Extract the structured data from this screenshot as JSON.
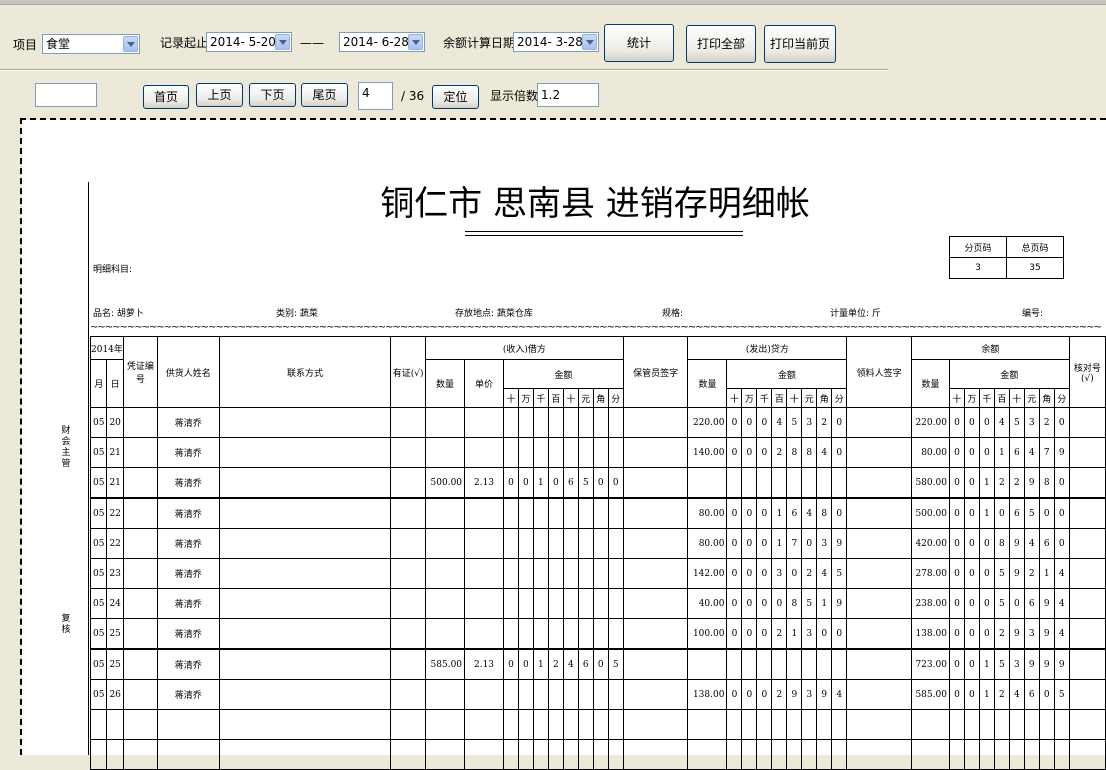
{
  "toolbar": {
    "project_label": "项目",
    "project_value": "食堂",
    "record_label": "记录起止",
    "date_from": "2014- 5-20",
    "dash": "——",
    "date_to": "2014- 6-28",
    "balance_label": "余额计算日期",
    "balance_date": "2014- 3-28",
    "stats_button": "统计",
    "print_all_button": "打印全部",
    "print_current_button": "打印当前页"
  },
  "nav": {
    "search_value": "",
    "first_button": "首页",
    "prev_button": "上页",
    "next_button": "下页",
    "last_button": "尾页",
    "page_value": "4",
    "page_total": "/ 36",
    "locate_button": "定位",
    "zoom_label": "显示倍数",
    "zoom_value": "1.2"
  },
  "doc": {
    "title": "铜仁市 思南县 进销存明细帐",
    "detail_subject": "明细科目:",
    "product_name": "品名: 胡萝卜",
    "category": "类别: 蔬菜",
    "storage": "存放地点: 蔬菜仓库",
    "spec": "规格:",
    "unit": "计量单位: 斤",
    "number": "编号:",
    "side_label_1": "财会主管",
    "side_label_2": "复核",
    "tilde": "~~~~~~~~~~~~~~~~~~~~~~~~~~~~~~~~~~~~~~~~~~~~~~~~~~~~~~~~~~~~~~~~~~~~~~~~~~~~~~~~~~~~~~~~~~~~~~~~~~~~~~~~~~~~~~~~~~~~~~~~~~~~~~~~~~~~~~~~~~~~~~~~~~~~~~~~~~~~~~~~~~~~~~~~~~~~~~~~~~~~~~~~~~~~~~~~~~~~"
  },
  "page_box": {
    "sub_page_label": "分页码",
    "total_page_label": "总页码",
    "sub_page": "3",
    "total_page": "35"
  },
  "headers": {
    "year": "2014年",
    "month": "月",
    "day": "日",
    "voucher": "凭证编号",
    "supplier": "供货人姓名",
    "contact": "联系方式",
    "has_voucher": "有证(√)",
    "in_section": "(收入)借方",
    "in_qty": "数量",
    "in_price": "单价",
    "in_amount": "金额",
    "keeper": "保管员签字",
    "out_section": "(发出)贷方",
    "out_qty": "数量",
    "out_amount": "金额",
    "receiver": "领料人签字",
    "bal_section": "余额",
    "bal_qty": "数量",
    "bal_amount": "金额",
    "check": "核对号(√)",
    "digits": [
      "十",
      "万",
      "千",
      "百",
      "十",
      "元",
      "角",
      "分"
    ]
  },
  "rows": [
    {
      "m": "05",
      "d": "20",
      "supplier": "蒋清乔",
      "in_qty": "",
      "in_price": "",
      "in_digits": [
        "",
        "",
        "",
        "",
        "",
        "",
        "",
        ""
      ],
      "out_qty": "220.00",
      "out_digits": [
        "0",
        "0",
        "0",
        "4",
        "5",
        "3",
        "2",
        "0"
      ],
      "bal_qty": "220.00",
      "bal_digits": [
        "0",
        "0",
        "0",
        "4",
        "5",
        "3",
        "2",
        "0"
      ]
    },
    {
      "m": "05",
      "d": "21",
      "supplier": "蒋清乔",
      "in_qty": "",
      "in_price": "",
      "in_digits": [
        "",
        "",
        "",
        "",
        "",
        "",
        "",
        ""
      ],
      "out_qty": "140.00",
      "out_digits": [
        "0",
        "0",
        "0",
        "2",
        "8",
        "8",
        "4",
        "0"
      ],
      "bal_qty": "80.00",
      "bal_digits": [
        "0",
        "0",
        "0",
        "1",
        "6",
        "4",
        "7",
        "9"
      ]
    },
    {
      "m": "05",
      "d": "21",
      "supplier": "蒋清乔",
      "in_qty": "500.00",
      "in_price": "2.13",
      "in_digits": [
        "0",
        "0",
        "1",
        "0",
        "6",
        "5",
        "0",
        "0"
      ],
      "out_qty": "",
      "out_digits": [
        "",
        "",
        "",
        "",
        "",
        "",
        "",
        ""
      ],
      "bal_qty": "580.00",
      "bal_digits": [
        "0",
        "0",
        "1",
        "2",
        "2",
        "9",
        "8",
        "0"
      ]
    },
    {
      "m": "05",
      "d": "22",
      "supplier": "蒋清乔",
      "in_qty": "",
      "in_price": "",
      "in_digits": [
        "",
        "",
        "",
        "",
        "",
        "",
        "",
        ""
      ],
      "out_qty": "80.00",
      "out_digits": [
        "0",
        "0",
        "0",
        "1",
        "6",
        "4",
        "8",
        "0"
      ],
      "bal_qty": "500.00",
      "bal_digits": [
        "0",
        "0",
        "1",
        "0",
        "6",
        "5",
        "0",
        "0"
      ]
    },
    {
      "m": "05",
      "d": "22",
      "supplier": "蒋清乔",
      "in_qty": "",
      "in_price": "",
      "in_digits": [
        "",
        "",
        "",
        "",
        "",
        "",
        "",
        ""
      ],
      "out_qty": "80.00",
      "out_digits": [
        "0",
        "0",
        "0",
        "1",
        "7",
        "0",
        "3",
        "9"
      ],
      "bal_qty": "420.00",
      "bal_digits": [
        "0",
        "0",
        "0",
        "8",
        "9",
        "4",
        "6",
        "0"
      ]
    },
    {
      "m": "05",
      "d": "23",
      "supplier": "蒋清乔",
      "in_qty": "",
      "in_price": "",
      "in_digits": [
        "",
        "",
        "",
        "",
        "",
        "",
        "",
        ""
      ],
      "out_qty": "142.00",
      "out_digits": [
        "0",
        "0",
        "0",
        "3",
        "0",
        "2",
        "4",
        "5"
      ],
      "bal_qty": "278.00",
      "bal_digits": [
        "0",
        "0",
        "0",
        "5",
        "9",
        "2",
        "1",
        "4"
      ]
    },
    {
      "m": "05",
      "d": "24",
      "supplier": "蒋清乔",
      "in_qty": "",
      "in_price": "",
      "in_digits": [
        "",
        "",
        "",
        "",
        "",
        "",
        "",
        ""
      ],
      "out_qty": "40.00",
      "out_digits": [
        "0",
        "0",
        "0",
        "0",
        "8",
        "5",
        "1",
        "9"
      ],
      "bal_qty": "238.00",
      "bal_digits": [
        "0",
        "0",
        "0",
        "5",
        "0",
        "6",
        "9",
        "4"
      ]
    },
    {
      "m": "05",
      "d": "25",
      "supplier": "蒋清乔",
      "in_qty": "",
      "in_price": "",
      "in_digits": [
        "",
        "",
        "",
        "",
        "",
        "",
        "",
        ""
      ],
      "out_qty": "100.00",
      "out_digits": [
        "0",
        "0",
        "0",
        "2",
        "1",
        "3",
        "0",
        "0"
      ],
      "bal_qty": "138.00",
      "bal_digits": [
        "0",
        "0",
        "0",
        "2",
        "9",
        "3",
        "9",
        "4"
      ]
    },
    {
      "m": "05",
      "d": "25",
      "supplier": "蒋清乔",
      "in_qty": "585.00",
      "in_price": "2.13",
      "in_digits": [
        "0",
        "0",
        "1",
        "2",
        "4",
        "6",
        "0",
        "5"
      ],
      "out_qty": "",
      "out_digits": [
        "",
        "",
        "",
        "",
        "",
        "",
        "",
        ""
      ],
      "bal_qty": "723.00",
      "bal_digits": [
        "0",
        "0",
        "1",
        "5",
        "3",
        "9",
        "9",
        "9"
      ]
    },
    {
      "m": "05",
      "d": "26",
      "supplier": "蒋清乔",
      "in_qty": "",
      "in_price": "",
      "in_digits": [
        "",
        "",
        "",
        "",
        "",
        "",
        "",
        ""
      ],
      "out_qty": "138.00",
      "out_digits": [
        "0",
        "0",
        "0",
        "2",
        "9",
        "3",
        "9",
        "4"
      ],
      "bal_qty": "585.00",
      "bal_digits": [
        "0",
        "0",
        "1",
        "2",
        "4",
        "6",
        "0",
        "5"
      ]
    },
    {
      "m": "",
      "d": "",
      "supplier": "",
      "in_qty": "",
      "in_price": "",
      "in_digits": [
        "",
        "",
        "",
        "",
        "",
        "",
        "",
        ""
      ],
      "out_qty": "",
      "out_digits": [
        "",
        "",
        "",
        "",
        "",
        "",
        "",
        ""
      ],
      "bal_qty": "",
      "bal_digits": [
        "",
        "",
        "",
        "",
        "",
        "",
        "",
        ""
      ]
    },
    {
      "m": "",
      "d": "",
      "supplier": "",
      "in_qty": "",
      "in_price": "",
      "in_digits": [
        "",
        "",
        "",
        "",
        "",
        "",
        "",
        ""
      ],
      "out_qty": "",
      "out_digits": [
        "",
        "",
        "",
        "",
        "",
        "",
        "",
        ""
      ],
      "bal_qty": "",
      "bal_digits": [
        "",
        "",
        "",
        "",
        "",
        "",
        "",
        ""
      ]
    }
  ]
}
